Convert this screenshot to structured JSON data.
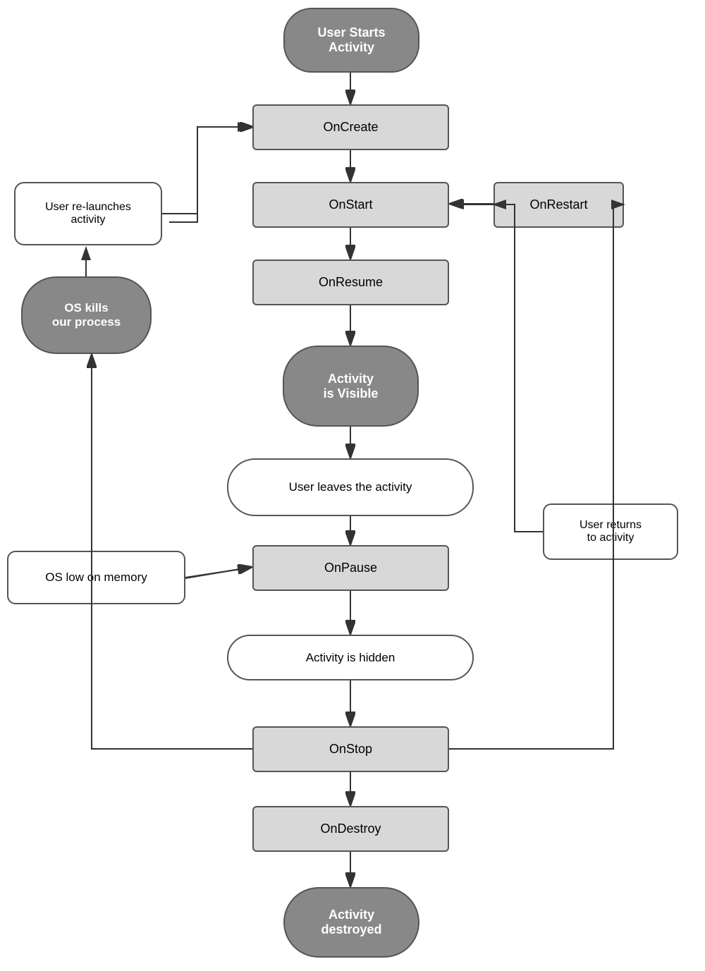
{
  "nodes": {
    "user_starts": {
      "label": "User Starts\nActivity"
    },
    "on_create": {
      "label": "OnCreate"
    },
    "on_start": {
      "label": "OnStart"
    },
    "on_resume": {
      "label": "OnResume"
    },
    "activity_visible": {
      "label": "Activity\nis Visible"
    },
    "user_leaves": {
      "label": "User leaves the activity"
    },
    "on_pause": {
      "label": "OnPause"
    },
    "activity_hidden": {
      "label": "Activity is hidden"
    },
    "on_stop": {
      "label": "OnStop"
    },
    "on_destroy": {
      "label": "OnDestroy"
    },
    "activity_destroyed": {
      "label": "Activity\ndestroyed"
    },
    "on_restart": {
      "label": "OnRestart"
    },
    "os_kills": {
      "label": "OS kills\nour process"
    },
    "user_relaunches": {
      "label": "User re-launches\nactivity"
    },
    "os_low_memory": {
      "label": "OS low on memory"
    },
    "user_returns": {
      "label": "User returns\nto activity"
    }
  }
}
